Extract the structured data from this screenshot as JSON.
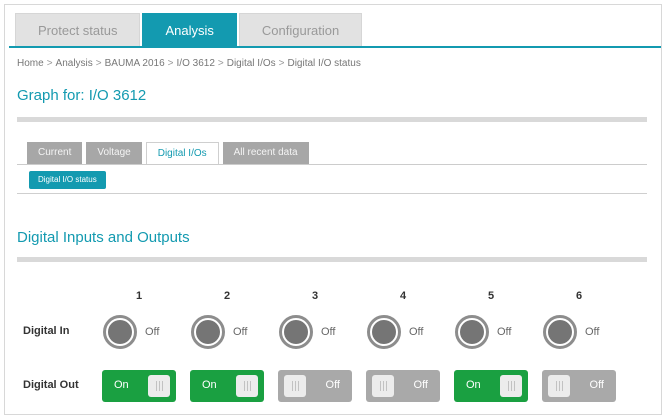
{
  "top_tabs": [
    {
      "label": "Protect status"
    },
    {
      "label": "Analysis"
    },
    {
      "label": "Configuration"
    }
  ],
  "breadcrumb": [
    "Home",
    "Analysis",
    "BAUMA 2016",
    "I/O 3612",
    "Digital I/Os",
    "Digital I/O status"
  ],
  "graph_title": "Graph for: I/O 3612",
  "sub_tabs": [
    {
      "label": "Current"
    },
    {
      "label": "Voltage"
    },
    {
      "label": "Digital I/Os"
    },
    {
      "label": "All recent data"
    }
  ],
  "sub_button": "Digital I/O status",
  "section_title": "Digital Inputs and Outputs",
  "columns": [
    "1",
    "2",
    "3",
    "4",
    "5",
    "6"
  ],
  "rows": {
    "digital_in_label": "Digital In",
    "digital_out_label": "Digital Out"
  },
  "inputs": [
    {
      "state": "Off"
    },
    {
      "state": "Off"
    },
    {
      "state": "Off"
    },
    {
      "state": "Off"
    },
    {
      "state": "Off"
    },
    {
      "state": "Off"
    }
  ],
  "outputs": [
    {
      "state": "On"
    },
    {
      "state": "On"
    },
    {
      "state": "Off"
    },
    {
      "state": "Off"
    },
    {
      "state": "On"
    },
    {
      "state": "Off"
    }
  ],
  "colors": {
    "accent": "#139ab0",
    "on": "#1aa041",
    "off": "#a9a9a9"
  }
}
